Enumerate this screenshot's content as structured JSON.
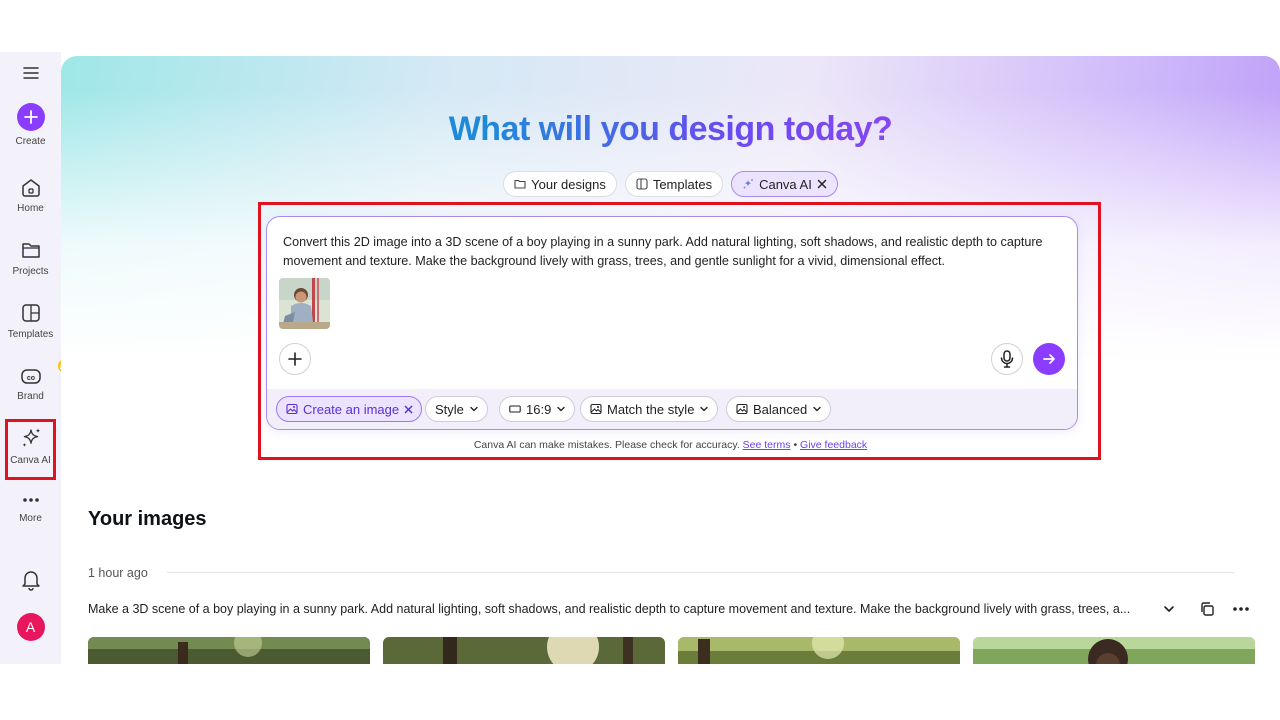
{
  "sidebar": {
    "items": [
      {
        "label": "Create",
        "icon": "plus-icon"
      },
      {
        "label": "Home",
        "icon": "home-icon"
      },
      {
        "label": "Projects",
        "icon": "folder-icon"
      },
      {
        "label": "Templates",
        "icon": "templates-icon"
      },
      {
        "label": "Brand",
        "icon": "brand-icon"
      },
      {
        "label": "Canva AI",
        "icon": "sparkle-icon"
      },
      {
        "label": "More",
        "icon": "more-dots-icon"
      }
    ],
    "avatar_initial": "A",
    "active_item": "Canva AI"
  },
  "hero": {
    "title": "What will you design today?",
    "tabs": [
      {
        "label": "Your designs",
        "icon": "folder-icon"
      },
      {
        "label": "Templates",
        "icon": "templates-icon"
      },
      {
        "label": "Canva AI",
        "icon": "sparkle-icon",
        "active": true
      }
    ]
  },
  "prompt": {
    "text": "Convert this 2D image into a 3D scene of a boy playing in a sunny park. Add natural lighting, soft shadows, and realistic depth to capture movement and texture. Make the background lively with grass, trees, and gentle sunlight for a vivid, dimensional effect.",
    "options": [
      {
        "label": "Create an image",
        "icon": "image-icon",
        "active": true
      },
      {
        "label": "Style",
        "icon": "chevron-down-icon"
      },
      {
        "label": "16:9",
        "icon": "aspect-ratio-icon"
      },
      {
        "label": "Match the style",
        "icon": "image-icon"
      },
      {
        "label": "Balanced",
        "icon": "image-icon"
      }
    ]
  },
  "disclaimer": {
    "text": "Canva AI can make mistakes. Please check for accuracy.",
    "terms_link": "See terms",
    "separator": "•",
    "feedback_link": "Give feedback"
  },
  "images_section": {
    "title": "Your images",
    "time": "1 hour ago",
    "prompt": "Make a 3D scene of a boy playing in a sunny park. Add natural lighting, soft shadows, and realistic depth to capture movement and texture. Make the background lively with grass, trees, a..."
  },
  "help_label": "?",
  "colors": {
    "accent": "#8b3dff",
    "highlight_border": "#e0121f",
    "link": "#6a42e8"
  }
}
